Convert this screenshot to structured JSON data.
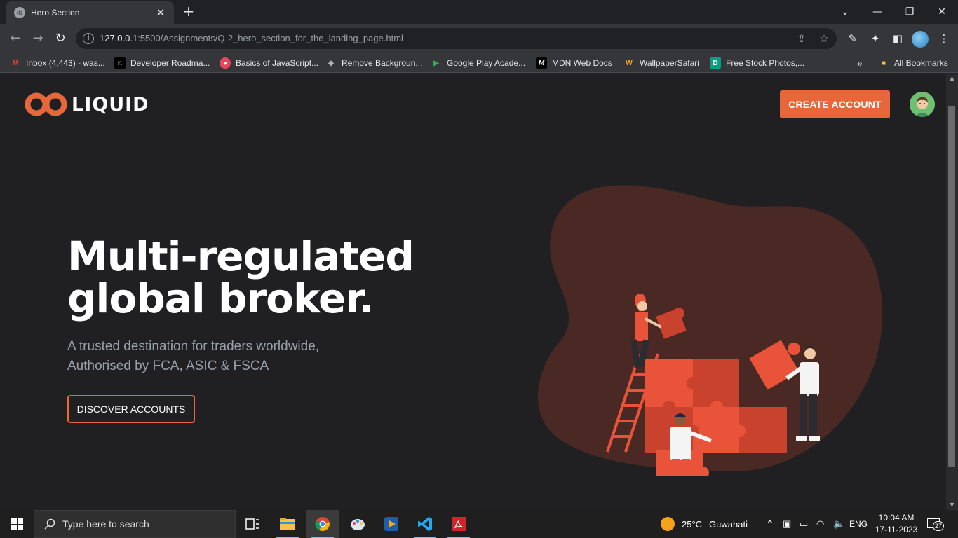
{
  "browser": {
    "tab_title": "Hero Section",
    "url_host": "127.0.0.1",
    "url_path": ":5500/Assignments/Q-2_hero_section_for_the_landing_page.html",
    "bookmarks": [
      {
        "label": "Inbox (4,443) - was...",
        "icon": "gmail-icon"
      },
      {
        "label": "Developer Roadma...",
        "icon": "roadmap-icon"
      },
      {
        "label": "Basics of JavaScript...",
        "icon": "js-basics-icon"
      },
      {
        "label": "Remove Backgroun...",
        "icon": "remove-bg-icon"
      },
      {
        "label": "Google Play Acade...",
        "icon": "google-play-icon"
      },
      {
        "label": "MDN Web Docs",
        "icon": "mdn-icon"
      },
      {
        "label": "WallpaperSafari",
        "icon": "wallpapersafari-icon"
      },
      {
        "label": "Free Stock Photos,...",
        "icon": "stock-photos-icon"
      }
    ],
    "all_bookmarks_label": "All Bookmarks",
    "overflow_label": "»"
  },
  "page": {
    "logo_text": "LIQUID",
    "cta_label": "CREATE ACCOUNT",
    "hero_title_line1": "Multi-regulated",
    "hero_title_line2": "global broker.",
    "hero_sub_line1": "A trusted destination for traders worldwide,",
    "hero_sub_line2": "Authorised by FCA, ASIC & FSCA",
    "discover_label": "DISCOVER ACCOUNTS",
    "accent_color": "#e8673a",
    "background_color": "#202023"
  },
  "taskbar": {
    "search_placeholder": "Type here to search",
    "weather_temp": "25°C",
    "weather_city": "Guwahati",
    "language": "ENG",
    "time": "10:04 AM",
    "date": "17-11-2023",
    "notification_count": "27"
  }
}
